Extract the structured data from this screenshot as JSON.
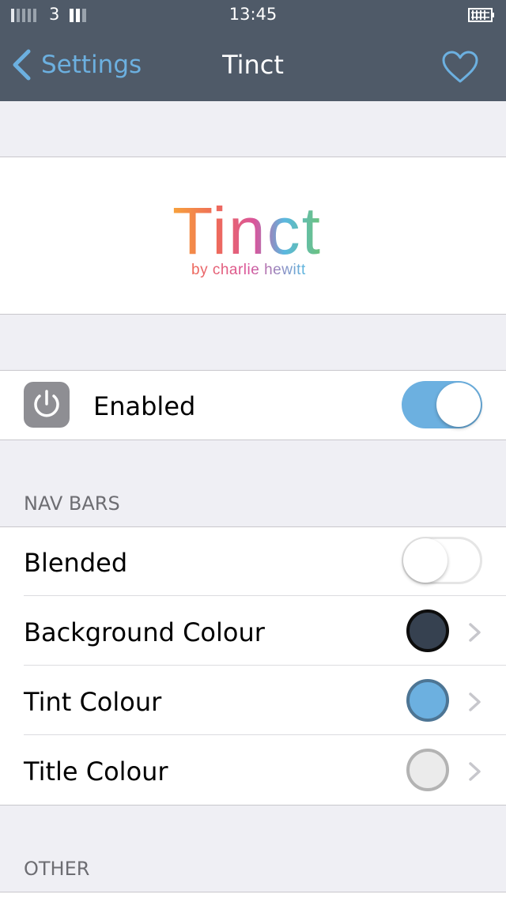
{
  "status_bar": {
    "carrier": "3",
    "time": "13:45"
  },
  "nav_bar": {
    "back_label": "Settings",
    "title": "Tinct",
    "background": "#4f5a68",
    "tint": "#6cb0e0"
  },
  "logo": {
    "name": "Tinct",
    "byline": "by charlie hewitt"
  },
  "enabled_row": {
    "label": "Enabled",
    "on": true
  },
  "nav_bars_section": {
    "header": "NAV BARS",
    "rows": [
      {
        "label": "Blended",
        "type": "toggle",
        "on": false
      },
      {
        "label": "Background Colour",
        "type": "color",
        "color": "#364150",
        "border": "#0d0d0d"
      },
      {
        "label": "Tint Colour",
        "type": "color",
        "color": "#6cb0e0",
        "border": "#4d7594"
      },
      {
        "label": "Title Colour",
        "type": "color",
        "color": "#ebebeb",
        "border": "#b3b3b3"
      }
    ]
  },
  "other_section": {
    "header": "OTHER"
  },
  "colors": {
    "toggle_on": "#6cb0e0",
    "toggle_off_border": "#e5e5e5",
    "background": "#efeff4"
  }
}
